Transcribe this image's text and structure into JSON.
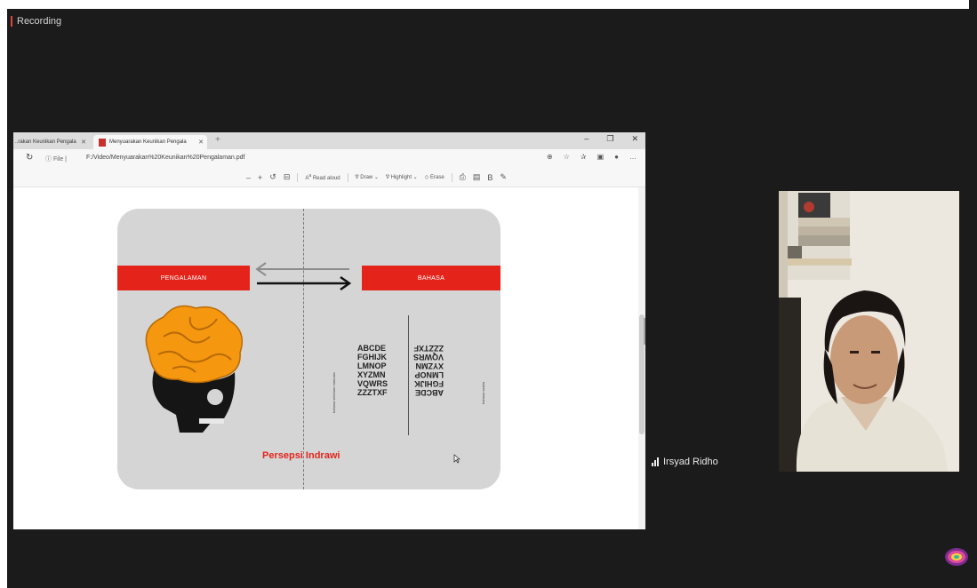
{
  "recording": {
    "label": "Recording"
  },
  "browser": {
    "tabs": [
      {
        "label": "..rakan Keunikan Pengala",
        "active": false
      },
      {
        "label": "Menyuarakan Keunikan Pengala",
        "active": true
      }
    ],
    "new_tab_glyph": "+",
    "window_controls": [
      "–",
      "❐",
      "✕"
    ],
    "address": {
      "scheme_label": "File",
      "url": "F:/Video/Menyuarakan%20Keunikan%20Pengalaman.pdf"
    },
    "pdf_toolbar": {
      "minus": "–",
      "plus": "+",
      "read_aloud": "Read aloud",
      "draw": "Draw",
      "highlight": "Highlight",
      "erase": "Erase"
    }
  },
  "slide": {
    "left_banner": "PENGALAMAN",
    "right_banner": "BAHASA",
    "alphabet_lines": [
      "ABCDE",
      "FGHIJK",
      "LMNOP",
      "XYZMN",
      "VQWRS",
      "ZZZTXF"
    ],
    "mirrored_lines": [
      "ABCDE",
      "FGHIJK",
      "LMNOP",
      "XYZMN",
      "VQWRS",
      "ZZZTXF"
    ],
    "left_vertical_label": "bahasa sebelum manusia",
    "right_vertical_label": "bahasa sastra",
    "caption": "Persepsi Indrawi"
  },
  "participant": {
    "name": "Irsyad Ridho"
  },
  "colors": {
    "accent_red": "#e4241b",
    "brain_orange": "#f6980f",
    "meeting_bg": "#1b1b1b"
  },
  "icons": [
    "refresh-icon",
    "info-icon",
    "pdf-icon",
    "signal-bars-icon",
    "brain-skull-illustration",
    "cursor-icon"
  ]
}
